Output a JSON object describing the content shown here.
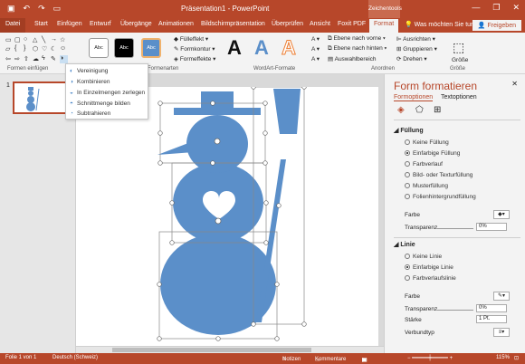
{
  "app": {
    "title": "Präsentation1 - PowerPoint",
    "contextual_group": "Zeichentools",
    "window_buttons": [
      "—",
      "❐",
      "✕"
    ]
  },
  "tabs": [
    "Datei",
    "Start",
    "Einfügen",
    "Entwurf",
    "Übergänge",
    "Animationen",
    "Bildschirmpräsentation",
    "Überprüfen",
    "Ansicht",
    "Foxit PDF",
    "Format"
  ],
  "search_placeholder": "Was möchten Sie tun?",
  "share_label": "Freigeben",
  "ribbon": {
    "groups": [
      "Formen einfügen",
      "Formenarten",
      "WordArt-Formate",
      "Anordnen",
      "Größe"
    ],
    "style_sample": "Abc",
    "shape_fill": "Fülleffekt",
    "shape_outline": "Formkontur",
    "shape_effects": "Formeffekte",
    "wordart_sample": "A",
    "bring_forward": "Ebene nach vorne",
    "send_backward": "Ebene nach hinten",
    "selection_pane": "Auswahlbereich",
    "align": "Ausrichten",
    "group": "Gruppieren",
    "rotate": "Drehen",
    "size_label": "Größe"
  },
  "merge_menu": {
    "items": [
      "Vereinigung",
      "Kombinieren",
      "In Einzelmengen zerlegen",
      "Schnittmenge bilden",
      "Subtrahieren"
    ]
  },
  "thumbnails": {
    "slide_number": "1"
  },
  "format_pane": {
    "title": "Form formatieren",
    "tabs": [
      "Formoptionen",
      "Textoptionen"
    ],
    "fill": {
      "header": "Füllung",
      "options": [
        "Keine Füllung",
        "Einfarbige Füllung",
        "Farbverlauf",
        "Bild- oder Texturfüllung",
        "Musterfüllung",
        "Folienhintergrundfüllung"
      ],
      "selected_index": 1,
      "color_label": "Farbe",
      "transparency_label": "Transparenz",
      "transparency_value": "0%"
    },
    "line": {
      "header": "Linie",
      "options": [
        "Keine Linie",
        "Einfarbige Linie",
        "Farbverlaufslinie"
      ],
      "selected_index": 1,
      "color_label": "Farbe",
      "transparency_label": "Transparenz",
      "transparency_value": "0%",
      "width_label": "Stärke",
      "width_value": "1 Pt.",
      "compound_label": "Verbundtyp"
    }
  },
  "status": {
    "slide_info": "Folie 1 von 1",
    "language": "Deutsch (Schweiz)",
    "notes": "Notizen",
    "comments": "Kommentare",
    "zoom": "115%"
  },
  "colors": {
    "accent": "#b7472a",
    "shape_fill": "#5b8fc9"
  }
}
